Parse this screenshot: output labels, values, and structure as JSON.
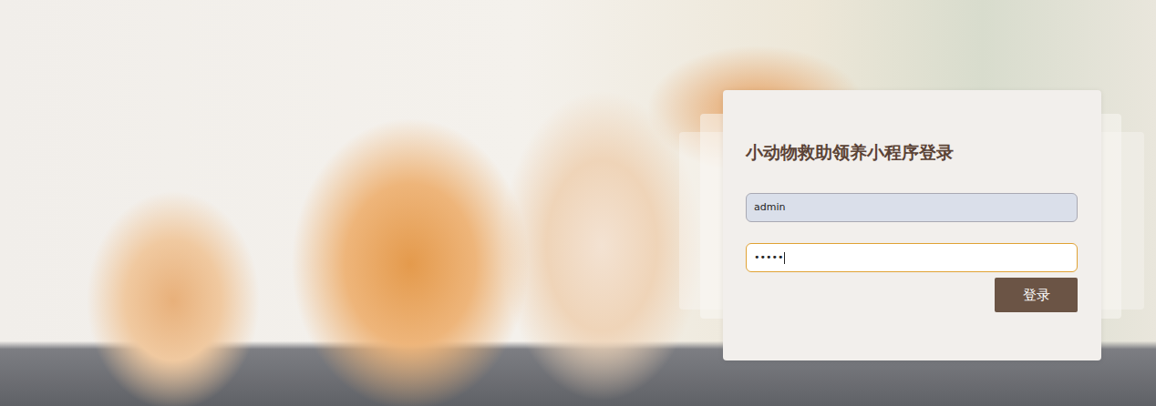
{
  "page": {
    "title": "小动物救助领养小程序登录"
  },
  "fields": [
    {
      "name": "username",
      "value": "admin",
      "focused": false,
      "autofilled": true
    },
    {
      "name": "password",
      "value": "•••••",
      "focused": true,
      "autofilled": false
    }
  ],
  "buttons": [
    {
      "label": "登录"
    }
  ]
}
